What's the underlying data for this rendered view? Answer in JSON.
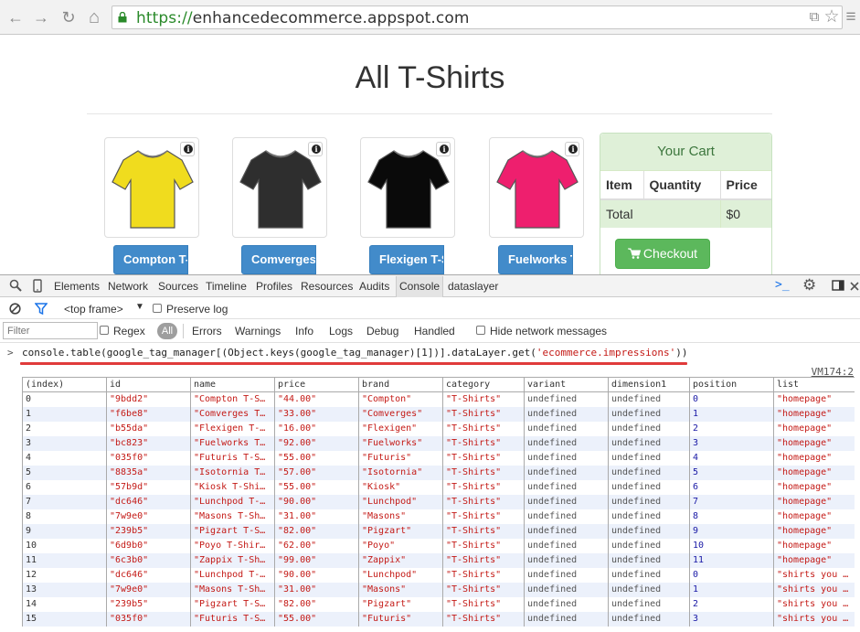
{
  "browser": {
    "back_icon": "←",
    "forward_icon": "→",
    "reload_icon": "↻",
    "home_icon": "⌂",
    "url_scheme": "https://",
    "url_host": "enhancedecommerce.appspot.com",
    "translate_icon": "⧉",
    "star_icon": "☆",
    "menu_icon": "≡"
  },
  "page": {
    "title": "All T-Shirts",
    "products": [
      {
        "button": "Compton T-Shirt",
        "color": "#f0dc1e"
      },
      {
        "button": "Comverges T-Shirt",
        "color": "#2e2e2e"
      },
      {
        "button": "Flexigen T-Shirt",
        "color": "#0a0a0a"
      },
      {
        "button": "Fuelworks T-Shirt",
        "color": "#ee1f6e"
      }
    ],
    "cart": {
      "title": "Your Cart",
      "col_item": "Item",
      "col_quantity": "Quantity",
      "col_price": "Price",
      "total_label": "Total",
      "total_value": "$0",
      "checkout": "Checkout"
    }
  },
  "devtools": {
    "tabs": [
      "Elements",
      "Network",
      "Sources",
      "Timeline",
      "Profiles",
      "Resources",
      "Audits",
      "Console",
      "dataslayer"
    ],
    "active_tab": "Console",
    "frame": "<top frame>",
    "preserve_log": "Preserve log",
    "filter_placeholder": "Filter",
    "regex": "Regex",
    "levels": [
      "All",
      "Errors",
      "Warnings",
      "Info",
      "Logs",
      "Debug",
      "Handled"
    ],
    "hide_network": "Hide network messages",
    "prompt": ">",
    "command_pre": "console.table(google_tag_manager[(Object.keys(google_tag_manager)[1])].dataLayer.get(",
    "command_str": "'ecommerce.impressions'",
    "command_post": "))",
    "vm_ref": "VM174:2",
    "table": {
      "headers": [
        "(index)",
        "id",
        "name",
        "price",
        "brand",
        "category",
        "variant",
        "dimension1",
        "position",
        "list"
      ],
      "rows": [
        [
          "0",
          "\"9bdd2\"",
          "\"Compton T-S…",
          "\"44.00\"",
          "\"Compton\"",
          "\"T-Shirts\"",
          "undefined",
          "undefined",
          "0",
          "\"homepage\""
        ],
        [
          "1",
          "\"f6be8\"",
          "\"Comverges T…",
          "\"33.00\"",
          "\"Comverges\"",
          "\"T-Shirts\"",
          "undefined",
          "undefined",
          "1",
          "\"homepage\""
        ],
        [
          "2",
          "\"b55da\"",
          "\"Flexigen T-…",
          "\"16.00\"",
          "\"Flexigen\"",
          "\"T-Shirts\"",
          "undefined",
          "undefined",
          "2",
          "\"homepage\""
        ],
        [
          "3",
          "\"bc823\"",
          "\"Fuelworks T…",
          "\"92.00\"",
          "\"Fuelworks\"",
          "\"T-Shirts\"",
          "undefined",
          "undefined",
          "3",
          "\"homepage\""
        ],
        [
          "4",
          "\"035f0\"",
          "\"Futuris T-S…",
          "\"55.00\"",
          "\"Futuris\"",
          "\"T-Shirts\"",
          "undefined",
          "undefined",
          "4",
          "\"homepage\""
        ],
        [
          "5",
          "\"8835a\"",
          "\"Isotornia T…",
          "\"57.00\"",
          "\"Isotornia\"",
          "\"T-Shirts\"",
          "undefined",
          "undefined",
          "5",
          "\"homepage\""
        ],
        [
          "6",
          "\"57b9d\"",
          "\"Kiosk T-Shi…",
          "\"55.00\"",
          "\"Kiosk\"",
          "\"T-Shirts\"",
          "undefined",
          "undefined",
          "6",
          "\"homepage\""
        ],
        [
          "7",
          "\"dc646\"",
          "\"Lunchpod T-…",
          "\"90.00\"",
          "\"Lunchpod\"",
          "\"T-Shirts\"",
          "undefined",
          "undefined",
          "7",
          "\"homepage\""
        ],
        [
          "8",
          "\"7w9e0\"",
          "\"Masons T-Sh…",
          "\"31.00\"",
          "\"Masons\"",
          "\"T-Shirts\"",
          "undefined",
          "undefined",
          "8",
          "\"homepage\""
        ],
        [
          "9",
          "\"239b5\"",
          "\"Pigzart T-S…",
          "\"82.00\"",
          "\"Pigzart\"",
          "\"T-Shirts\"",
          "undefined",
          "undefined",
          "9",
          "\"homepage\""
        ],
        [
          "10",
          "\"6d9b0\"",
          "\"Poyo T-Shir…",
          "\"62.00\"",
          "\"Poyo\"",
          "\"T-Shirts\"",
          "undefined",
          "undefined",
          "10",
          "\"homepage\""
        ],
        [
          "11",
          "\"6c3b0\"",
          "\"Zappix T-Sh…",
          "\"99.00\"",
          "\"Zappix\"",
          "\"T-Shirts\"",
          "undefined",
          "undefined",
          "11",
          "\"homepage\""
        ],
        [
          "12",
          "\"dc646\"",
          "\"Lunchpod T-…",
          "\"90.00\"",
          "\"Lunchpod\"",
          "\"T-Shirts\"",
          "undefined",
          "undefined",
          "0",
          "\"shirts you …"
        ],
        [
          "13",
          "\"7w9e0\"",
          "\"Masons T-Sh…",
          "\"31.00\"",
          "\"Masons\"",
          "\"T-Shirts\"",
          "undefined",
          "undefined",
          "1",
          "\"shirts you …"
        ],
        [
          "14",
          "\"239b5\"",
          "\"Pigzart T-S…",
          "\"82.00\"",
          "\"Pigzart\"",
          "\"T-Shirts\"",
          "undefined",
          "undefined",
          "2",
          "\"shirts you …"
        ],
        [
          "15",
          "\"035f0\"",
          "\"Futuris T-S…",
          "\"55.00\"",
          "\"Futuris\"",
          "\"T-Shirts\"",
          "undefined",
          "undefined",
          "3",
          "\"shirts you …"
        ]
      ]
    }
  }
}
